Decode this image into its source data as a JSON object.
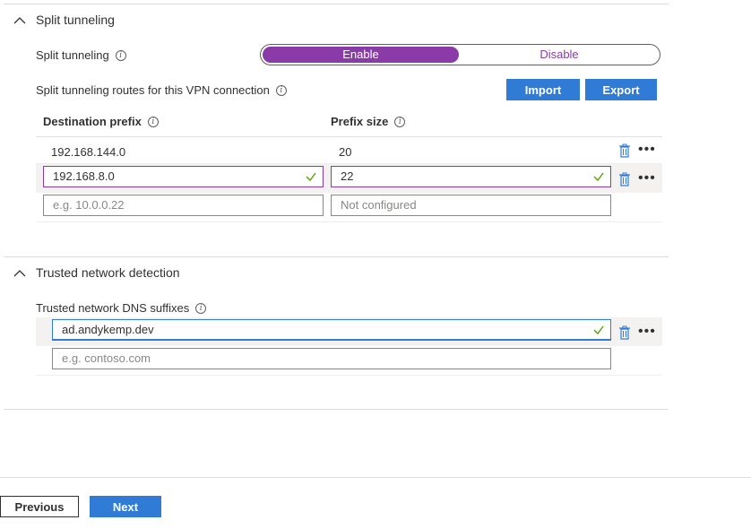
{
  "split": {
    "section_title": "Split tunneling",
    "toggle_label": "Split tunneling",
    "enable_label": "Enable",
    "disable_label": "Disable",
    "routes_label": "Split tunneling routes for this VPN connection",
    "import_label": "Import",
    "export_label": "Export",
    "col_dest": "Destination prefix",
    "col_size": "Prefix size",
    "rows": [
      {
        "prefix": "192.168.144.0",
        "size": "20"
      },
      {
        "prefix": "192.168.8.0",
        "size": "22"
      }
    ],
    "new_prefix_placeholder": "e.g. 10.0.0.22",
    "new_size_placeholder": "Not configured"
  },
  "trusted": {
    "section_title": "Trusted network detection",
    "dns_label": "Trusted network DNS suffixes",
    "dns_value": "ad.andykemp.dev",
    "dns_placeholder": "e.g. contoso.com"
  },
  "footer": {
    "previous_label": "Previous",
    "next_label": "Next"
  },
  "colors": {
    "accent_purple": "#8a3ba8",
    "primary_blue": "#2f7bd6",
    "valid_green": "#57a300"
  }
}
